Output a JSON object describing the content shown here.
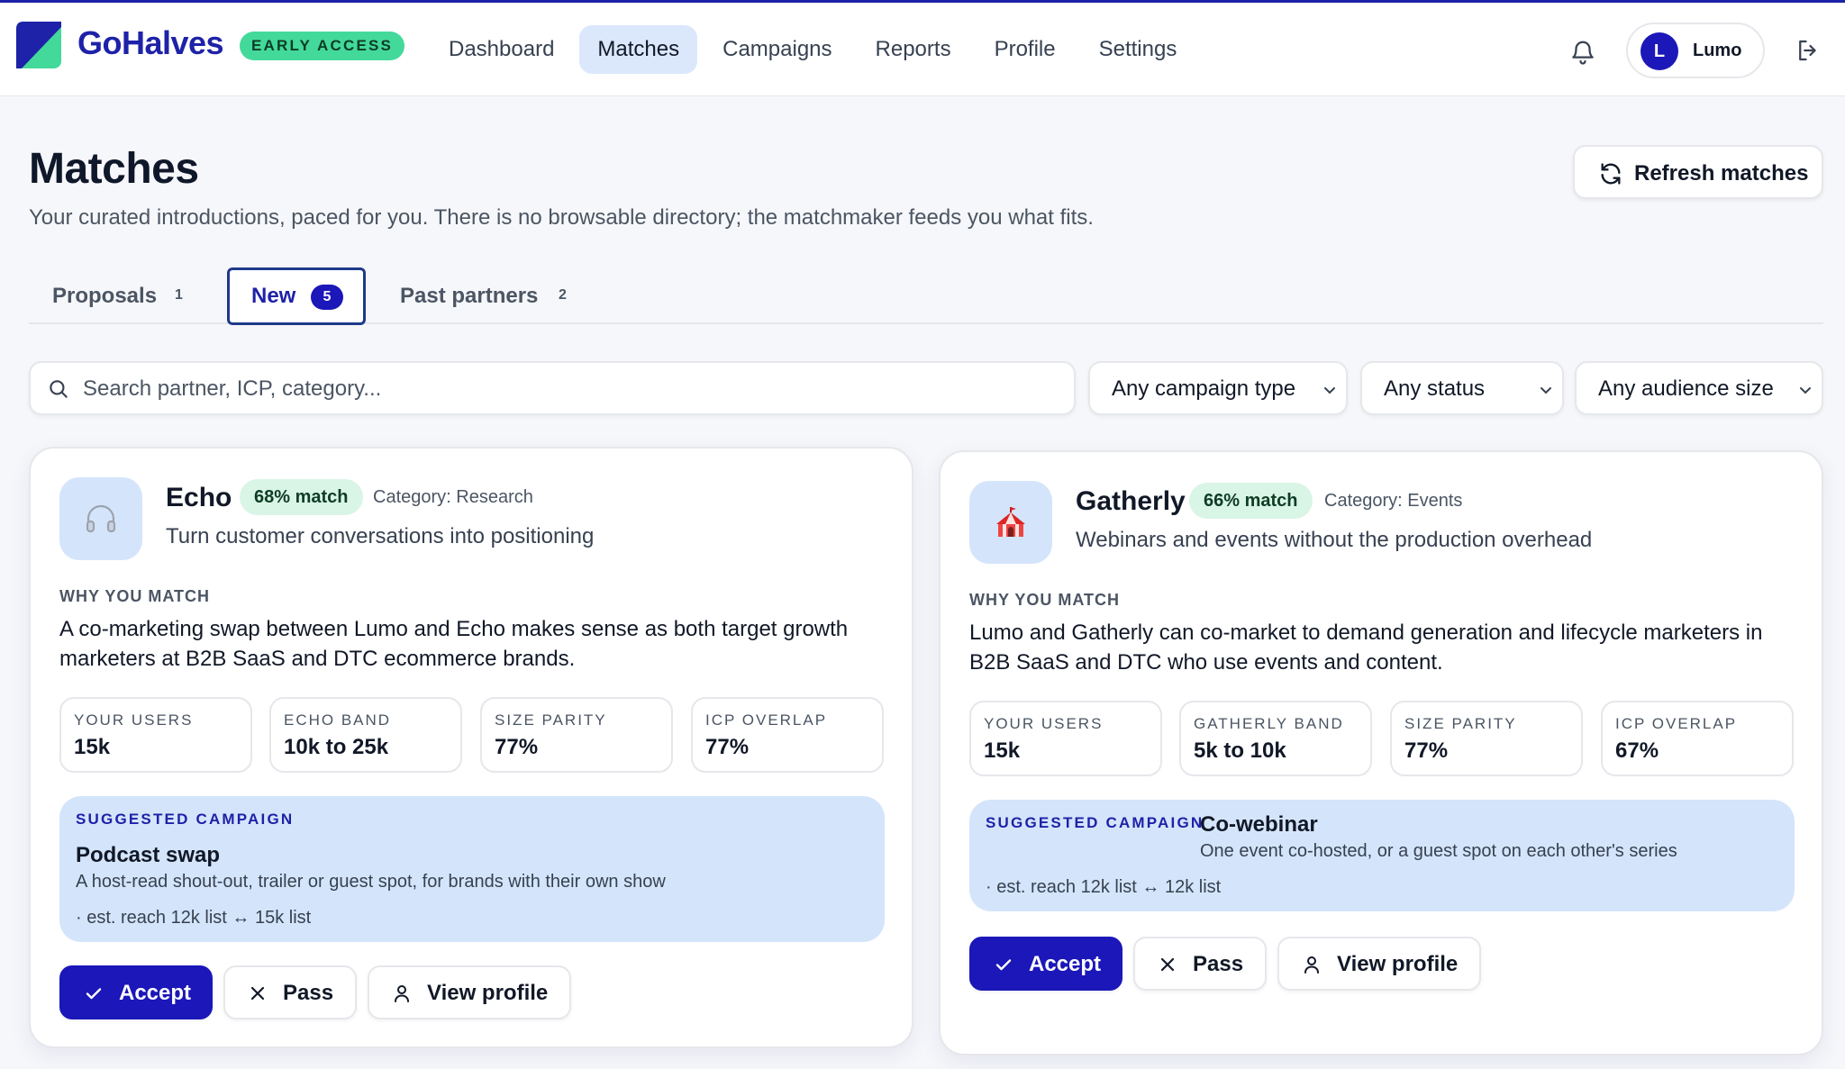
{
  "app": {
    "brand": "GoHalves",
    "badge": "EARLY ACCESS",
    "accent": "#1b17b8",
    "brand_green": "#43d99a"
  },
  "nav": {
    "items": [
      {
        "label": "Dashboard",
        "active": false
      },
      {
        "label": "Matches",
        "active": true
      },
      {
        "label": "Campaigns",
        "active": false
      },
      {
        "label": "Reports",
        "active": false
      },
      {
        "label": "Profile",
        "active": false
      },
      {
        "label": "Settings",
        "active": false
      }
    ]
  },
  "user": {
    "initial": "L",
    "name": "Lumo"
  },
  "page": {
    "title": "Matches",
    "subtitle": "Your curated introductions, paced for you. There is no browsable directory; the matchmaker feeds you what fits.",
    "refresh_label": "Refresh matches"
  },
  "tabs": [
    {
      "label": "Proposals",
      "count": "1",
      "active": false
    },
    {
      "label": "New",
      "count": "5",
      "active": true
    },
    {
      "label": "Past partners",
      "count": "2",
      "active": false
    }
  ],
  "filters": {
    "search_placeholder": "Search partner, ICP, category...",
    "campaign_type": "Any campaign type",
    "status": "Any status",
    "audience_size": "Any audience size"
  },
  "cards": [
    {
      "name": "Echo",
      "icon": "headphones-icon",
      "match": "68% match",
      "category": "Category: Research",
      "tagline": "Turn customer conversations into positioning",
      "why_heading": "WHY YOU MATCH",
      "why": "A co-marketing swap between Lumo and Echo makes sense as both target growth marketers at B2B SaaS and DTC ecommerce brands.",
      "stats": [
        {
          "label": "YOUR USERS",
          "value": "15k"
        },
        {
          "label": "ECHO BAND",
          "value": "10k to 25k"
        },
        {
          "label": "SIZE PARITY",
          "value": "77%"
        },
        {
          "label": "ICP OVERLAP",
          "value": "77%"
        }
      ],
      "campaign": {
        "heading": "SUGGESTED CAMPAIGN",
        "title": "Podcast swap",
        "desc": "A host-read shout-out, trailer or guest spot, for brands with their own show",
        "reach": "· est. reach 12k list ↔ 15k list"
      },
      "actions": {
        "accept": "Accept",
        "pass": "Pass",
        "view": "View profile"
      }
    },
    {
      "name": "Gatherly",
      "icon": "circus-tent-icon",
      "match": "66% match",
      "category": "Category: Events",
      "tagline": "Webinars and events without the production overhead",
      "why_heading": "WHY YOU MATCH",
      "why": "Lumo and Gatherly can co-market to demand generation and lifecycle marketers in B2B SaaS and DTC who use events and content.",
      "stats": [
        {
          "label": "YOUR USERS",
          "value": "15k"
        },
        {
          "label": "GATHERLY BAND",
          "value": "5k to 10k"
        },
        {
          "label": "SIZE PARITY",
          "value": "77%"
        },
        {
          "label": "ICP OVERLAP",
          "value": "67%"
        }
      ],
      "campaign": {
        "heading": "SUGGESTED CAMPAIGN",
        "title": "Co-webinar",
        "desc": "One event co-hosted, or a guest spot on each other's series",
        "reach": "· est. reach 12k list ↔ 12k list"
      },
      "actions": {
        "accept": "Accept",
        "pass": "Pass",
        "view": "View profile"
      }
    }
  ]
}
